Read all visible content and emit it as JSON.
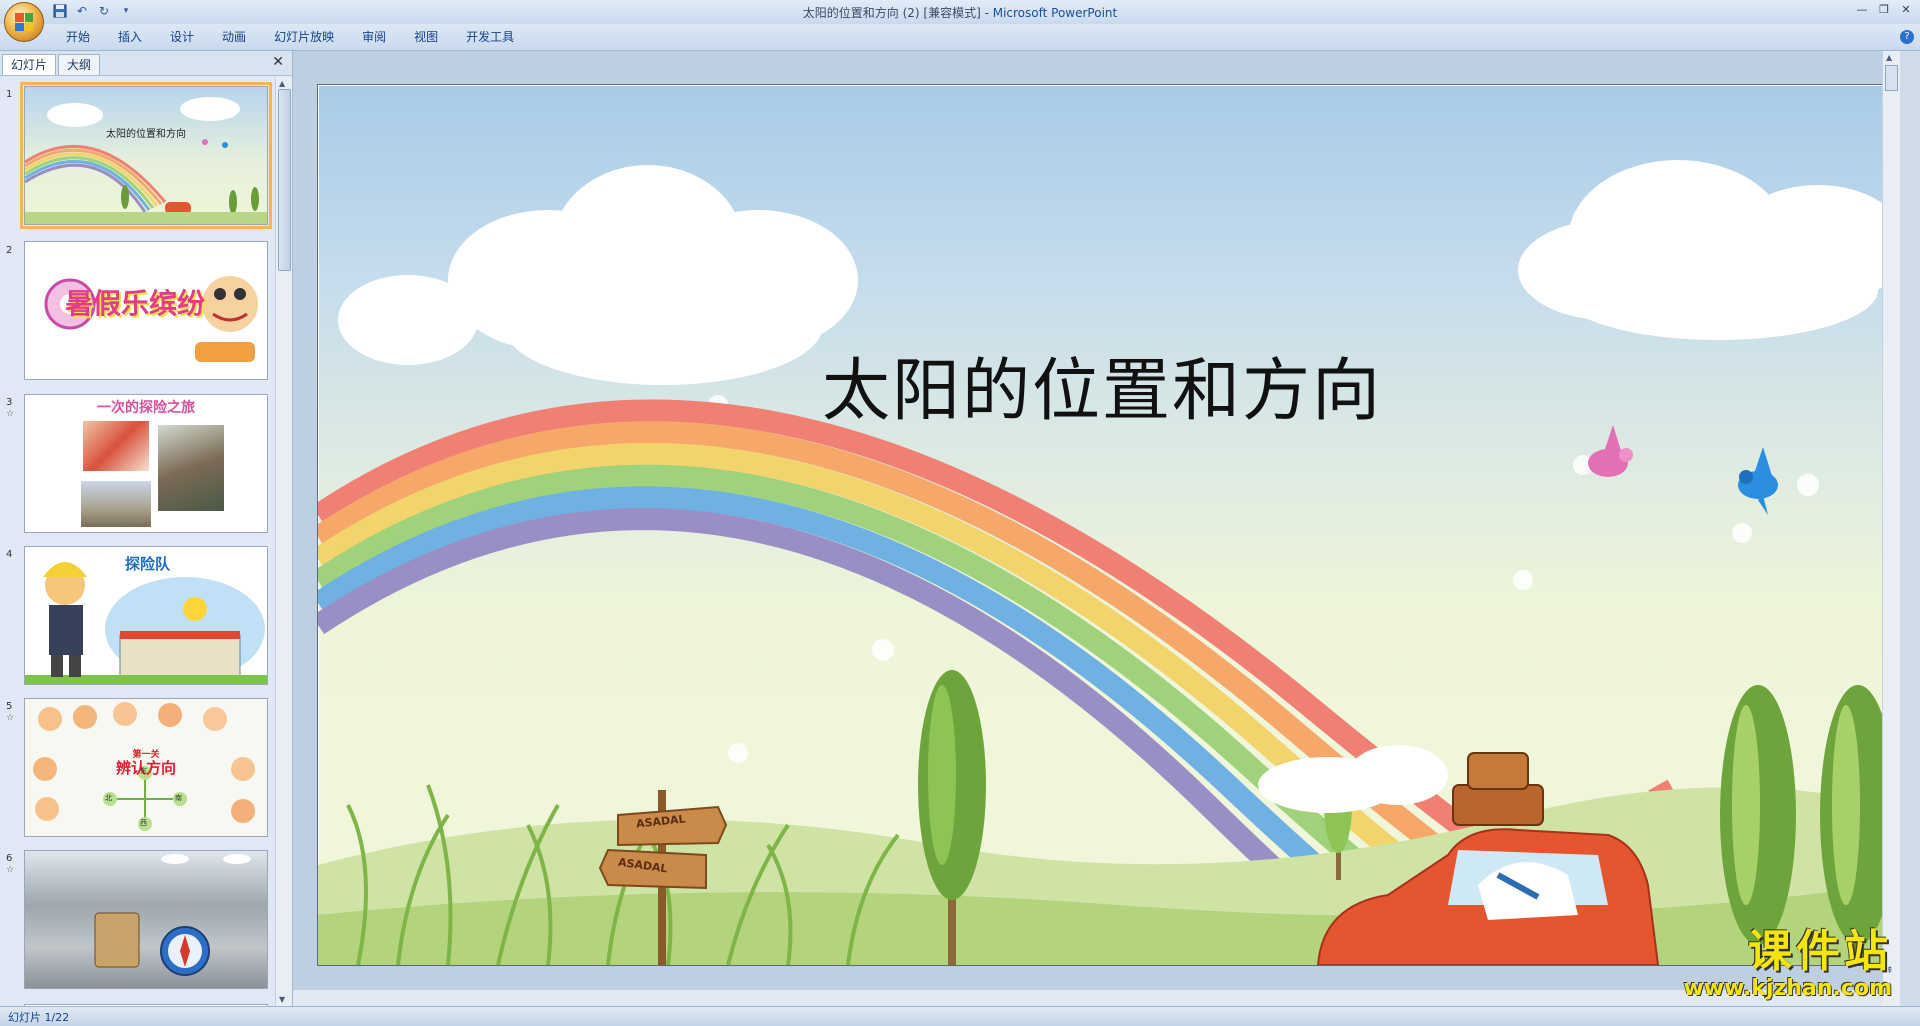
{
  "window": {
    "title": "太阳的位置和方向 (2) [兼容模式] - ",
    "app_name": "Microsoft PowerPoint",
    "controls": [
      "—",
      "❐",
      "✕"
    ]
  },
  "quick_access": {
    "icons": [
      "save-icon",
      "undo-icon",
      "redo-icon",
      "customize-icon"
    ]
  },
  "ribbon": {
    "tabs": [
      "开始",
      "插入",
      "设计",
      "动画",
      "幻灯片放映",
      "审阅",
      "视图",
      "开发工具"
    ],
    "help": "?"
  },
  "left_pane": {
    "tab_slides": "幻灯片",
    "tab_outline": "大纲",
    "close": "✕",
    "thumbnails": [
      {
        "number": "1",
        "title": "太阳的位置和方向",
        "has_star": false,
        "selected": true
      },
      {
        "number": "2",
        "title": "暑假乐缤纷",
        "has_star": false,
        "selected": false
      },
      {
        "number": "3",
        "title": "一次的探险之旅",
        "has_star": true,
        "selected": false
      },
      {
        "number": "4",
        "title": "探险队",
        "has_star": false,
        "selected": false
      },
      {
        "number": "5",
        "title": "辨认方向",
        "subtitle": "第一关",
        "compass": [
          "东",
          "北",
          "南",
          "西"
        ],
        "has_star": true,
        "selected": false
      },
      {
        "number": "6",
        "title": "",
        "has_star": true,
        "selected": false
      }
    ]
  },
  "slide": {
    "title": "太阳的位置和方向",
    "sign1": "ASADAL",
    "sign2": "ASADAL"
  },
  "status": {
    "slide_counter": "幻灯片 1/22"
  },
  "watermark": {
    "name": "课件站",
    "url": "www.kjzhan.com"
  },
  "colors": {
    "rainbow": [
      "#f08074",
      "#f5a86a",
      "#f3d46c",
      "#9fd27a",
      "#6eb1e2",
      "#9a8fc4"
    ],
    "accent_orange": "#f8b454",
    "ribbon_text": "#15428b"
  }
}
